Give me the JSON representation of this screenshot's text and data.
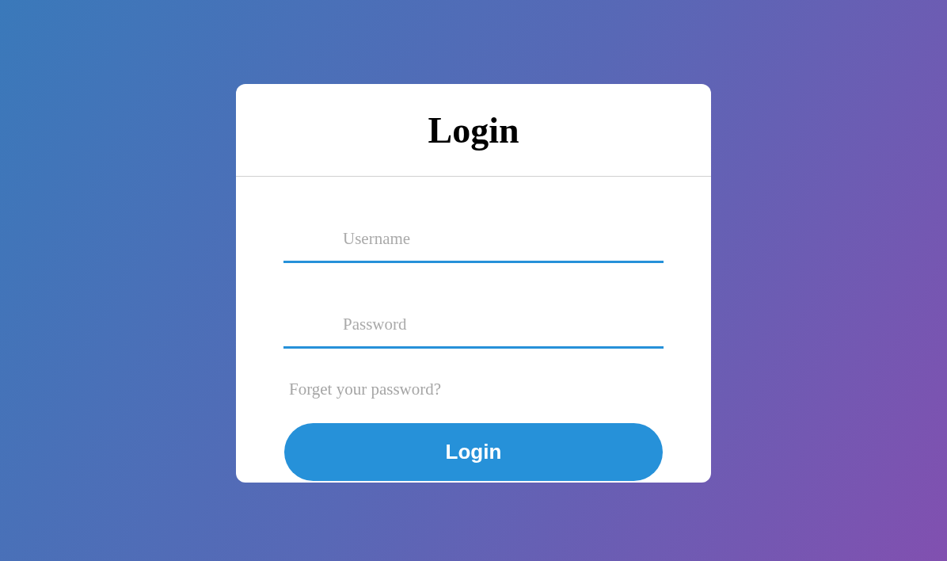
{
  "card": {
    "title": "Login"
  },
  "fields": [
    {
      "placeholder": "Username"
    },
    {
      "placeholder": "Password"
    }
  ],
  "forgot_link": "Forget your password?",
  "submit_button": "Login"
}
